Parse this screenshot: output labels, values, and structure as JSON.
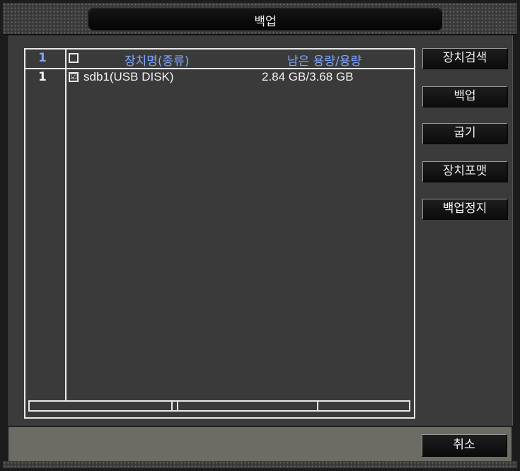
{
  "window": {
    "title": "백업"
  },
  "list": {
    "header": {
      "num": "1",
      "name": "장치명(종류)",
      "capacity": "남은 용량/용량"
    },
    "rows": [
      {
        "num": "1",
        "checked": true,
        "check_glyph": "☑",
        "name": "sdb1(USB DISK)",
        "capacity": "2.84 GB/3.68 GB"
      }
    ]
  },
  "buttons": {
    "search": "장치검색",
    "backup": "백업",
    "burn": "굽기",
    "format": "장치포맷",
    "stop": "백업정지",
    "cancel": "취소"
  },
  "colors": {
    "header_text": "#7fa6ff",
    "text": "#f2f2f2",
    "panel": "#3b3b3b",
    "bottom_bar": "#6c6c64"
  }
}
